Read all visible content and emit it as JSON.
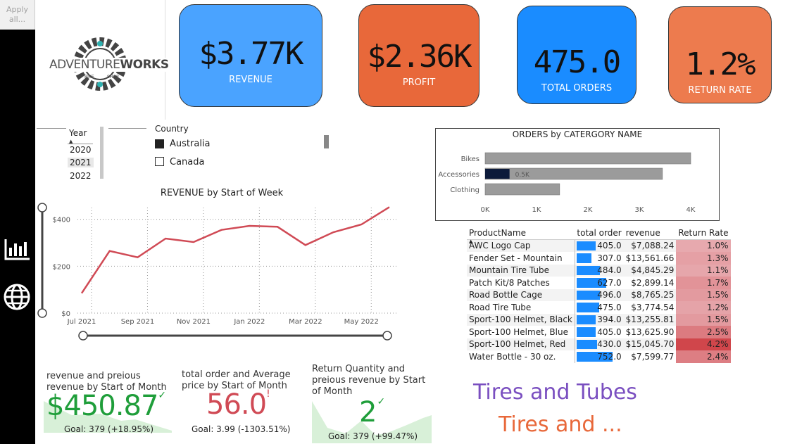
{
  "apply_button": {
    "line1": "Apply",
    "line2": "all..."
  },
  "logo": {
    "text_adventure": "ADVENTURE",
    "text_works": "WORKS",
    "text_bike": "BIKE",
    "text_shop": "SHOP"
  },
  "kpis": [
    {
      "value": "$3.77K",
      "label": "REVENUE",
      "color": "#4aa3ff"
    },
    {
      "value": "$2.36K",
      "label": "PROFIT",
      "color": "#e8683a"
    },
    {
      "value": "475.0",
      "label": "TOTAL ORDERS",
      "color": "#1a8cff"
    },
    {
      "value": "1.2%",
      "label": "RETURN RATE",
      "color": "#ed7b4e"
    }
  ],
  "year_slicer": {
    "title": "Year",
    "items": [
      "2020",
      "2021",
      "2022"
    ],
    "selected": "2021"
  },
  "country_slicer": {
    "title": "Country",
    "items": [
      {
        "label": "Australia",
        "checked": true
      },
      {
        "label": "Canada",
        "checked": false
      }
    ]
  },
  "chart_data": [
    {
      "type": "line",
      "title": "REVENUE by Start of Week",
      "x": [
        "Jul 2021",
        "Aug 2021",
        "Sep 2021",
        "Oct 2021",
        "Nov 2021",
        "Dec 2021",
        "Jan 2022",
        "Feb 2022",
        "Mar 2022",
        "Apr 2022",
        "May 2022",
        "Jun 2022"
      ],
      "values": [
        85,
        265,
        238,
        318,
        303,
        355,
        372,
        368,
        290,
        345,
        378,
        452
      ],
      "x_tick_labels": [
        "Jul 2021",
        "Sep 2021",
        "Nov 2021",
        "Jan 2022",
        "Mar 2022",
        "May 2022"
      ],
      "y_tick_labels": [
        "$0",
        "$200",
        "$400"
      ],
      "ylim": [
        0,
        450
      ],
      "color": "#d04a55"
    },
    {
      "type": "bar",
      "title": "ORDERS by CATERGORY NAME",
      "categories": [
        "Bikes",
        "Accessories",
        "Clothing"
      ],
      "values": [
        4000,
        3450,
        1450
      ],
      "highlight_values": [
        0,
        475,
        0
      ],
      "highlight_label": "0.5K",
      "x_tick_labels": [
        "0K",
        "1K",
        "2K",
        "3K",
        "4K"
      ],
      "xlim": [
        0,
        4000
      ],
      "color": "#9b9b9b",
      "highlight_color": "#0c1a3a"
    }
  ],
  "product_table": {
    "headers": [
      "ProductName",
      "total order",
      "revenue",
      "Return Rate"
    ],
    "rows": [
      {
        "name": "AWC Logo Cap",
        "orders": 405.0,
        "orders_text": "405.0",
        "revenue": "$7,088.24",
        "rate": 1.0,
        "rate_text": "1.0%"
      },
      {
        "name": "Fender Set - Mountain",
        "orders": 307.0,
        "orders_text": "307.0",
        "revenue": "$13,561.66",
        "rate": 1.3,
        "rate_text": "1.3%"
      },
      {
        "name": "Mountain Tire Tube",
        "orders": 484.0,
        "orders_text": "484.0",
        "revenue": "$4,845.29",
        "rate": 1.1,
        "rate_text": "1.1%"
      },
      {
        "name": "Patch Kit/8 Patches",
        "orders": 627.0,
        "orders_text": "627.0",
        "revenue": "$2,899.14",
        "rate": 1.7,
        "rate_text": "1.7%"
      },
      {
        "name": "Road Bottle Cage",
        "orders": 496.0,
        "orders_text": "496.0",
        "revenue": "$8,765.25",
        "rate": 1.5,
        "rate_text": "1.5%"
      },
      {
        "name": "Road Tire Tube",
        "orders": 475.0,
        "orders_text": "475.0",
        "revenue": "$3,774.54",
        "rate": 1.2,
        "rate_text": "1.2%"
      },
      {
        "name": "Sport-100 Helmet, Black",
        "orders": 394.0,
        "orders_text": "394.0",
        "revenue": "$13,255.81",
        "rate": 1.5,
        "rate_text": "1.5%"
      },
      {
        "name": "Sport-100 Helmet, Blue",
        "orders": 405.0,
        "orders_text": "405.0",
        "revenue": "$13,625.90",
        "rate": 2.5,
        "rate_text": "2.5%"
      },
      {
        "name": "Sport-100 Helmet, Red",
        "orders": 430.0,
        "orders_text": "430.0",
        "revenue": "$15,045.70",
        "rate": 4.2,
        "rate_text": "4.2%"
      },
      {
        "name": "Water Bottle - 30 oz.",
        "orders": 752.0,
        "orders_text": "752.0",
        "revenue": "$7,599.77",
        "rate": 2.4,
        "rate_text": "2.4%"
      }
    ],
    "bar_color": "#1a8cff",
    "orders_max": 800
  },
  "cards": [
    {
      "title": "revenue and preious revenue by Start of Month",
      "value": "$450.87",
      "mark": "✓",
      "goal": "Goal: 379 (+18.95%)",
      "value_color": "#1f9e3a"
    },
    {
      "title": "total order and Average price by Start of Month",
      "value": "56.0",
      "mark": "!",
      "goal": "Goal: 3.99 (-1303.51%)",
      "value_color": "#d04a55"
    },
    {
      "title": "Return Quantity and preious revenue by Start of Month",
      "value": "2",
      "mark": "✓",
      "goal": "Goal: 379 (+99.47%)",
      "value_color": "#1f9e3a"
    }
  ],
  "text_boxes": [
    {
      "text": "Tires and Tubes",
      "color": "#7a4fc0"
    },
    {
      "text": "Tires and ...",
      "color": "#e8683a"
    }
  ]
}
